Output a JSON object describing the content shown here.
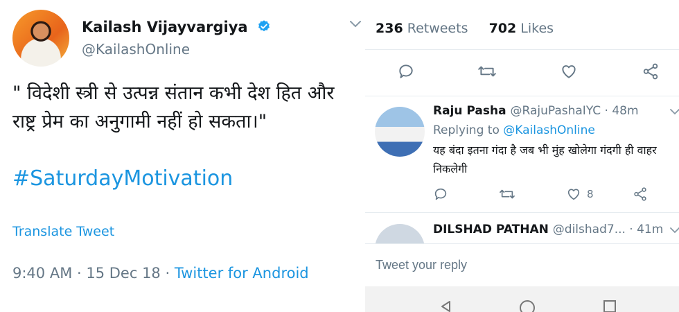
{
  "tweet": {
    "author_name": "Kailash Vijayvargiya",
    "author_handle": "@KailashOnline",
    "text": "\" विदेशी स्त्री से उत्पन्न संतान कभी देश हित और राष्ट्र प्रेम का अनुगामी नहीं हो सकता।\"",
    "hashtag": "#SaturdayMotivation",
    "translate_label": "Translate Tweet",
    "time": "9:40 AM",
    "date": "15 Dec 18",
    "separator": " · ",
    "source": "Twitter for Android"
  },
  "stats": {
    "retweets_count": "236",
    "retweets_label": "Retweets",
    "likes_count": "702",
    "likes_label": "Likes"
  },
  "icons": {
    "reply": "reply-icon",
    "retweet": "retweet-icon",
    "like": "heart-icon",
    "share": "share-icon",
    "verified": "verified-badge-icon",
    "chevron": "chevron-down-icon"
  },
  "replies": [
    {
      "name": "Raju Pasha",
      "handle": "@RajuPashaIYC · 48m",
      "replying_prefix": "Replying to",
      "replying_to": "@KailashOnline",
      "text": "यह बंदा इतना गंदा है जब भी मुंह खोलेगा गंदगी ही वाहर निकलेगी",
      "like_count": "8"
    },
    {
      "name": "DILSHAD PATHAN",
      "handle": "@dilshad7... · 41m"
    }
  ],
  "reply_box": {
    "placeholder": "Tweet your reply"
  },
  "colors": {
    "link": "#1b95e0",
    "muted": "#657786",
    "text": "#14171a",
    "divider": "#e6ecf0"
  }
}
